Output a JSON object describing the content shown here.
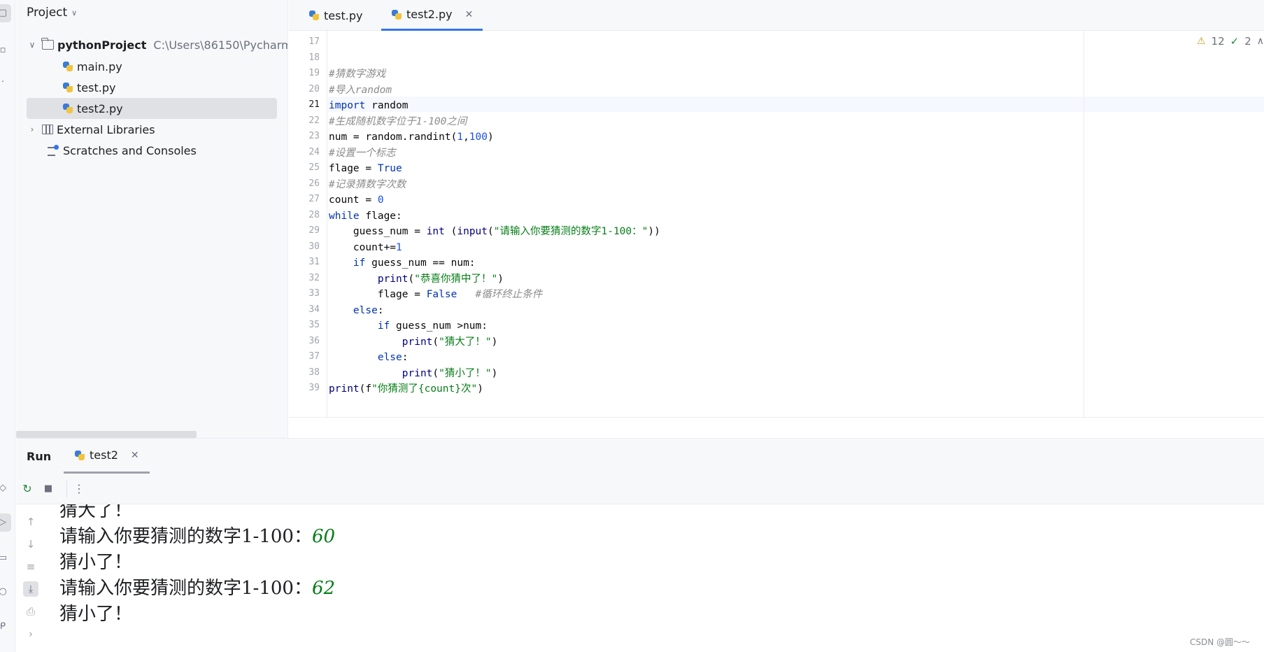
{
  "project": {
    "title": "Project",
    "root": {
      "name": "pythonProject",
      "path": "C:\\Users\\86150\\Pycharm"
    },
    "files": [
      "main.py",
      "test.py",
      "test2.py"
    ],
    "external_libraries": "External Libraries",
    "scratches": "Scratches and Consoles"
  },
  "editor": {
    "tabs": [
      {
        "label": "test.py",
        "active": false
      },
      {
        "label": "test2.py",
        "active": true
      }
    ],
    "inspections": {
      "warnings": "12",
      "ok": "2"
    },
    "lines": [
      {
        "n": "17"
      },
      {
        "n": "18"
      },
      {
        "n": "19",
        "text": "#猜数字游戏"
      },
      {
        "n": "20",
        "text": "#导入random"
      },
      {
        "n": "21",
        "kw": "import",
        "rest": " random"
      },
      {
        "n": "22",
        "text": "#生成随机数字位于1-100之间"
      },
      {
        "n": "23",
        "a": "num = random.randint(",
        "n1": "1",
        "b": ",",
        "n2": "100",
        "c": ")"
      },
      {
        "n": "24",
        "text": "#设置一个标志"
      },
      {
        "n": "25",
        "a": "flage = ",
        "kw": "True"
      },
      {
        "n": "26",
        "text": "#记录猜数字次数"
      },
      {
        "n": "27",
        "a": "count = ",
        "num": "0"
      },
      {
        "n": "28",
        "kw": "while",
        "rest": " flage:"
      },
      {
        "n": "29",
        "a": "    guess_num = ",
        "fn1": "int",
        "b": " (",
        "fn2": "input",
        "c": "(",
        "str": "\"请输入你要猜测的数字1-100：\"",
        "d": "))"
      },
      {
        "n": "30",
        "a": "    count+=",
        "num": "1"
      },
      {
        "n": "31",
        "a": "    ",
        "kw": "if",
        "rest": " guess_num == num:"
      },
      {
        "n": "32",
        "a": "        ",
        "fn": "print",
        "b": "(",
        "str": "\"恭喜你猜中了！\"",
        "c": ")"
      },
      {
        "n": "33",
        "a": "        flage = ",
        "kw": "False",
        "b": "   ",
        "cm": "#循环终止条件"
      },
      {
        "n": "34",
        "a": "    ",
        "kw": "else",
        "rest": ":"
      },
      {
        "n": "35",
        "a": "        ",
        "kw": "if",
        "rest": " guess_num >num:"
      },
      {
        "n": "36",
        "a": "            ",
        "fn": "print",
        "b": "(",
        "str": "\"猜大了！\"",
        "c": ")"
      },
      {
        "n": "37",
        "a": "        ",
        "kw": "else",
        "rest": ":"
      },
      {
        "n": "38",
        "a": "            ",
        "fn": "print",
        "b": "(",
        "str": "\"猜小了！\"",
        "c": ")"
      },
      {
        "n": "39",
        "fn": "print",
        "b": "(f",
        "str": "\"你猜测了{count}次\"",
        "c": ")"
      }
    ]
  },
  "run": {
    "title": "Run",
    "tab": "test2",
    "output": [
      {
        "text": "猜大了！"
      },
      {
        "text": "请输入你要猜测的数字1-100：",
        "input": "60"
      },
      {
        "text": "猜小了！"
      },
      {
        "text": "请输入你要猜测的数字1-100：",
        "input": "62"
      },
      {
        "text": "猜小了！"
      }
    ]
  },
  "watermark": "CSDN @圆～～",
  "colors": {
    "accent": "#3574f0",
    "keyword": "#0033b3",
    "string": "#067d17",
    "number": "#1750eb",
    "comment": "#8c8c8c"
  }
}
